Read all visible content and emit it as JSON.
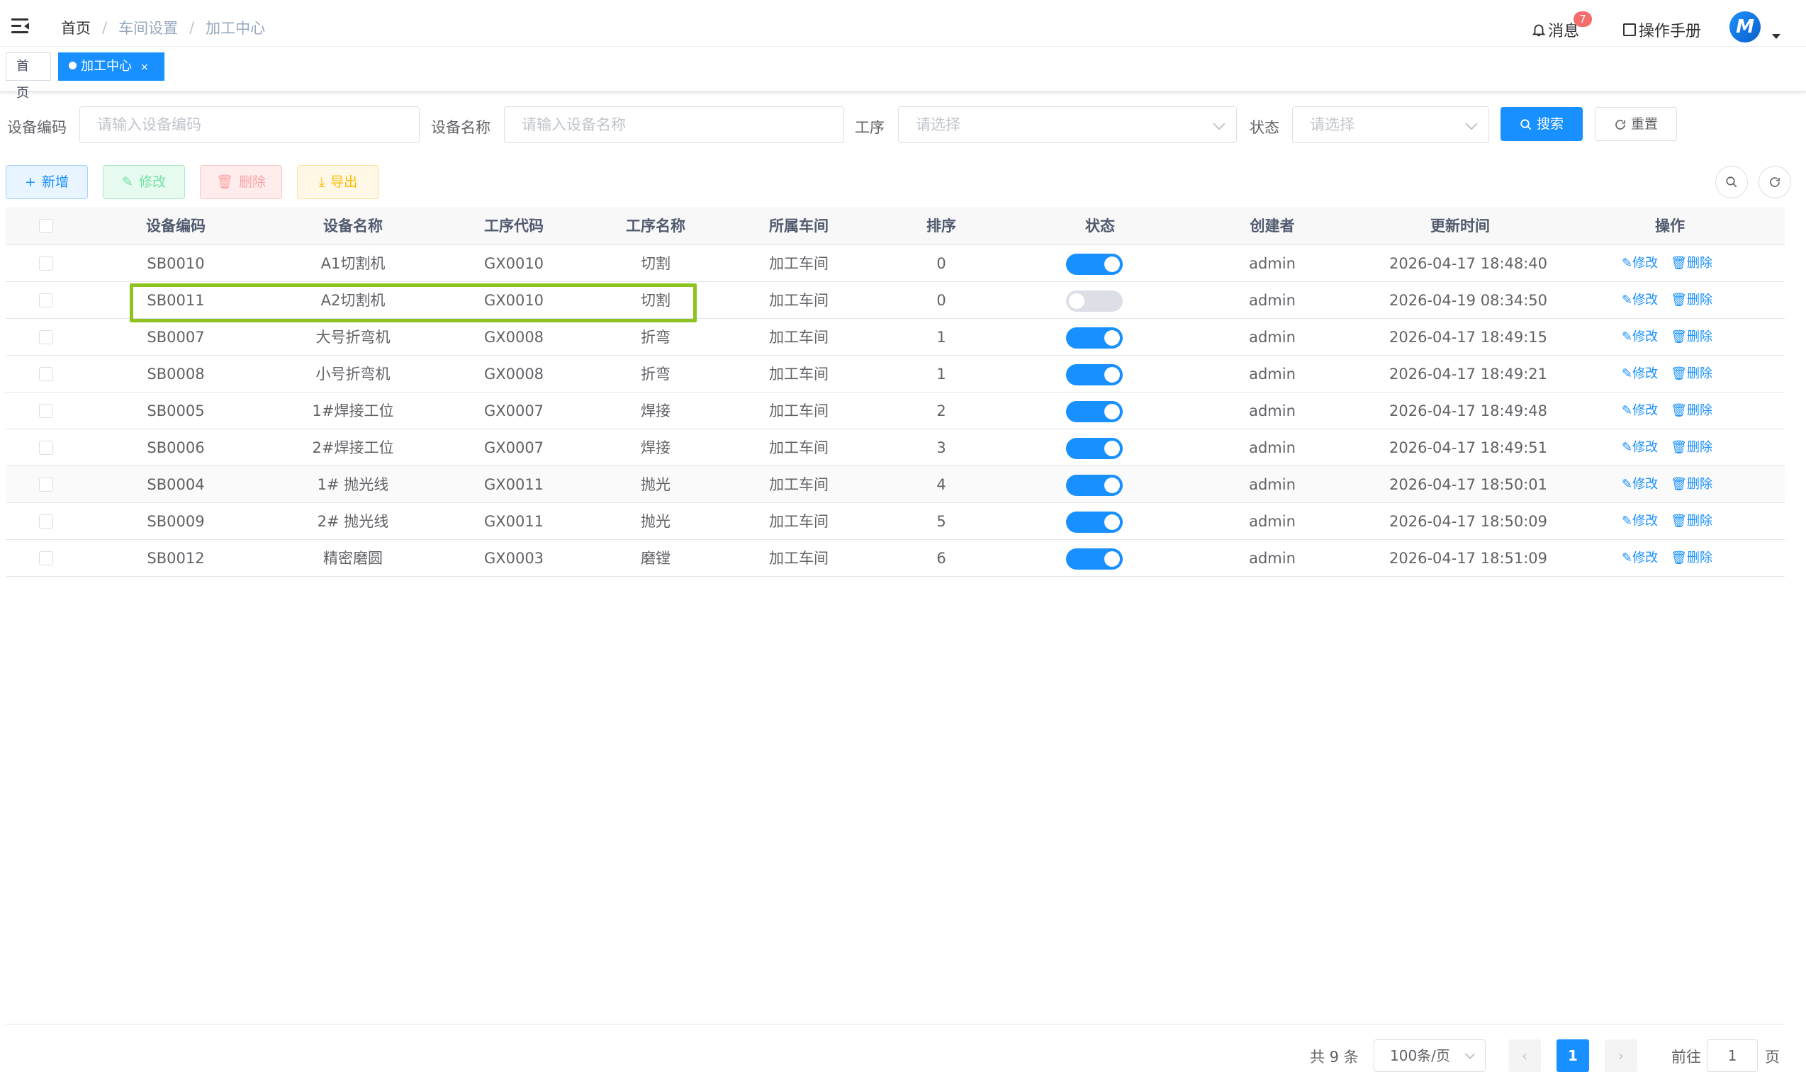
{
  "navbar": {
    "breadcrumb": [
      "首页",
      "车间设置",
      "加工中心"
    ],
    "messages_label": "消息",
    "messages_badge": "7",
    "manual_label": "操作手册",
    "avatar_letter": "M"
  },
  "tags": {
    "home": "首页",
    "active": "加工中心",
    "close": "×"
  },
  "search": {
    "code_label": "设备编码",
    "code_placeholder": "请输入设备编码",
    "name_label": "设备名称",
    "name_placeholder": "请输入设备名称",
    "process_label": "工序",
    "process_placeholder": "请选择",
    "status_label": "状态",
    "status_placeholder": "请选择",
    "search_btn": "搜索",
    "reset_btn": "重置"
  },
  "toolbar": {
    "add": "新增",
    "edit": "修改",
    "delete": "删除",
    "export": "导出"
  },
  "table": {
    "columns": [
      "设备编码",
      "设备名称",
      "工序代码",
      "工序名称",
      "所属车间",
      "排序",
      "状态",
      "创建者",
      "更新时间",
      "操作"
    ],
    "edit_label": "修改",
    "delete_label": "删除",
    "rows": [
      {
        "code": "SB0010",
        "name": "A1切割机",
        "proc_code": "GX0010",
        "proc_name": "切割",
        "workshop": "加工车间",
        "sort": "0",
        "status": true,
        "creator": "admin",
        "updated": "2026-04-17 18:48:40"
      },
      {
        "code": "SB0011",
        "name": "A2切割机",
        "proc_code": "GX0010",
        "proc_name": "切割",
        "workshop": "加工车间",
        "sort": "0",
        "status": false,
        "creator": "admin",
        "updated": "2026-04-19 08:34:50"
      },
      {
        "code": "SB0007",
        "name": "大号折弯机",
        "proc_code": "GX0008",
        "proc_name": "折弯",
        "workshop": "加工车间",
        "sort": "1",
        "status": true,
        "creator": "admin",
        "updated": "2026-04-17 18:49:15"
      },
      {
        "code": "SB0008",
        "name": "小号折弯机",
        "proc_code": "GX0008",
        "proc_name": "折弯",
        "workshop": "加工车间",
        "sort": "1",
        "status": true,
        "creator": "admin",
        "updated": "2026-04-17 18:49:21"
      },
      {
        "code": "SB0005",
        "name": "1#焊接工位",
        "proc_code": "GX0007",
        "proc_name": "焊接",
        "workshop": "加工车间",
        "sort": "2",
        "status": true,
        "creator": "admin",
        "updated": "2026-04-17 18:49:48"
      },
      {
        "code": "SB0006",
        "name": "2#焊接工位",
        "proc_code": "GX0007",
        "proc_name": "焊接",
        "workshop": "加工车间",
        "sort": "3",
        "status": true,
        "creator": "admin",
        "updated": "2026-04-17 18:49:51"
      },
      {
        "code": "SB0004",
        "name": "1# 抛光线",
        "proc_code": "GX0011",
        "proc_name": "抛光",
        "workshop": "加工车间",
        "sort": "4",
        "status": true,
        "creator": "admin",
        "updated": "2026-04-17 18:50:01"
      },
      {
        "code": "SB0009",
        "name": "2# 抛光线",
        "proc_code": "GX0011",
        "proc_name": "抛光",
        "workshop": "加工车间",
        "sort": "5",
        "status": true,
        "creator": "admin",
        "updated": "2026-04-17 18:50:09"
      },
      {
        "code": "SB0012",
        "name": "精密磨圆",
        "proc_code": "GX0003",
        "proc_name": "磨镗",
        "workshop": "加工车间",
        "sort": "6",
        "status": true,
        "creator": "admin",
        "updated": "2026-04-17 18:51:09"
      }
    ]
  },
  "pagination": {
    "total_text": "共 9 条",
    "page_size": "100条/页",
    "current_page": "1",
    "goto_label": "前往",
    "goto_value": "1",
    "page_suffix": "页"
  },
  "colors": {
    "primary": "#1890ff",
    "highlight": "#8ec31f",
    "badge": "#f56c6c"
  }
}
